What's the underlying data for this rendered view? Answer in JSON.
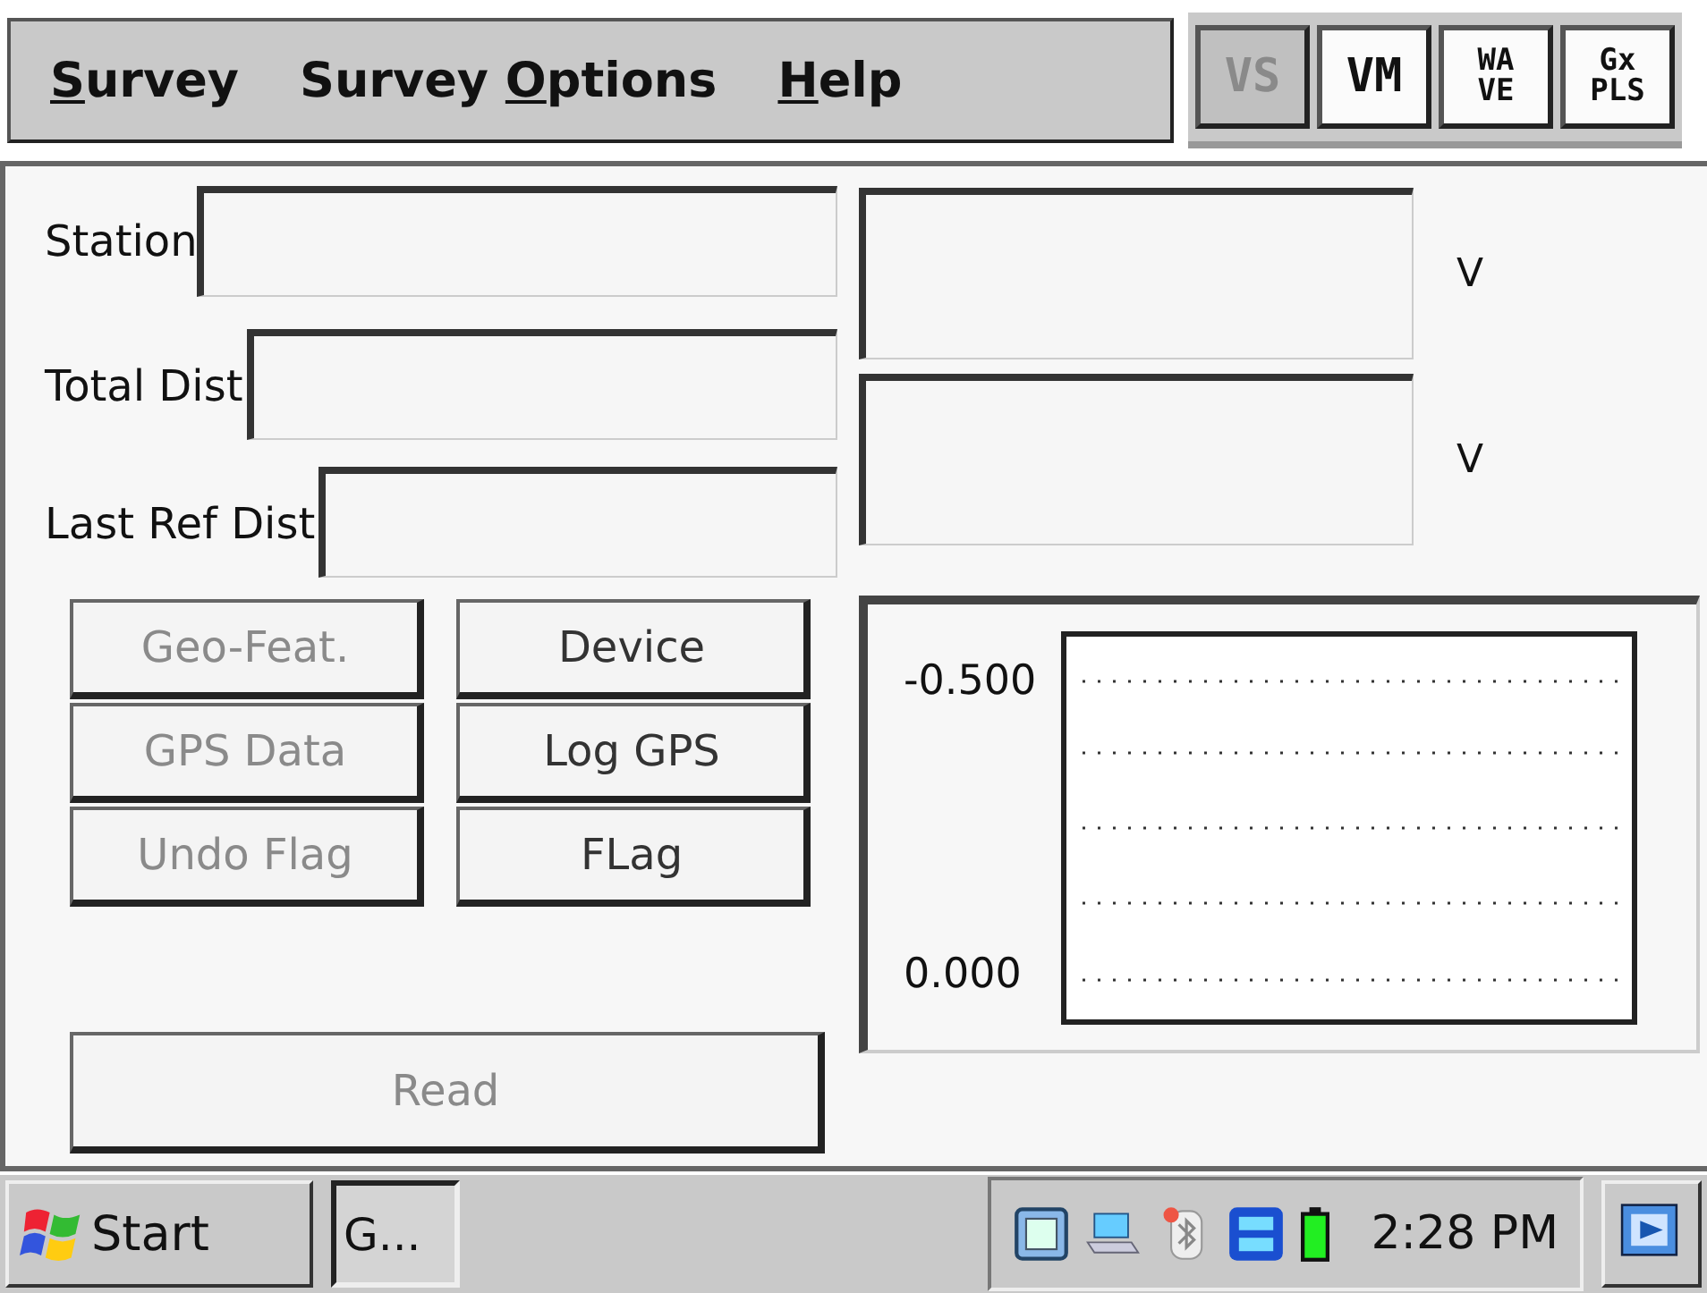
{
  "menu_bar": {
    "items": [
      {
        "mnemonic": "S",
        "after": "urvey"
      },
      {
        "before": "Survey ",
        "mnemonic": "O",
        "after": "ptions"
      },
      {
        "mnemonic": "H",
        "after": "elp"
      }
    ]
  },
  "toolbar": [
    {
      "lines": [
        "VS"
      ],
      "disabled": true
    },
    {
      "lines": [
        "VM"
      ],
      "disabled": false
    },
    {
      "lines": [
        "WA",
        "VE"
      ],
      "disabled": false
    },
    {
      "lines": [
        "Gx",
        "PLS"
      ],
      "disabled": false
    }
  ],
  "fields": [
    {
      "label": "Station"
    },
    {
      "label": "Total Dist"
    },
    {
      "label": "Last Ref Dist"
    }
  ],
  "readouts": [
    {
      "unit": "V"
    },
    {
      "unit": "V"
    }
  ],
  "buttons": [
    {
      "label": "Geo-Feat.",
      "disabled": true
    },
    {
      "label": "Device",
      "disabled": false
    },
    {
      "label": "GPS Data",
      "disabled": true
    },
    {
      "label": "Log GPS",
      "disabled": false
    },
    {
      "label": "Undo Flag",
      "disabled": true
    },
    {
      "label": "FLag",
      "disabled": false
    }
  ],
  "read_button": {
    "label": "Read",
    "disabled": true
  },
  "plot": {
    "y_labels": [
      "-0.500",
      "0.000"
    ]
  },
  "taskbar": {
    "start": "Start",
    "task": "G...",
    "clock": "2:28 PM"
  }
}
